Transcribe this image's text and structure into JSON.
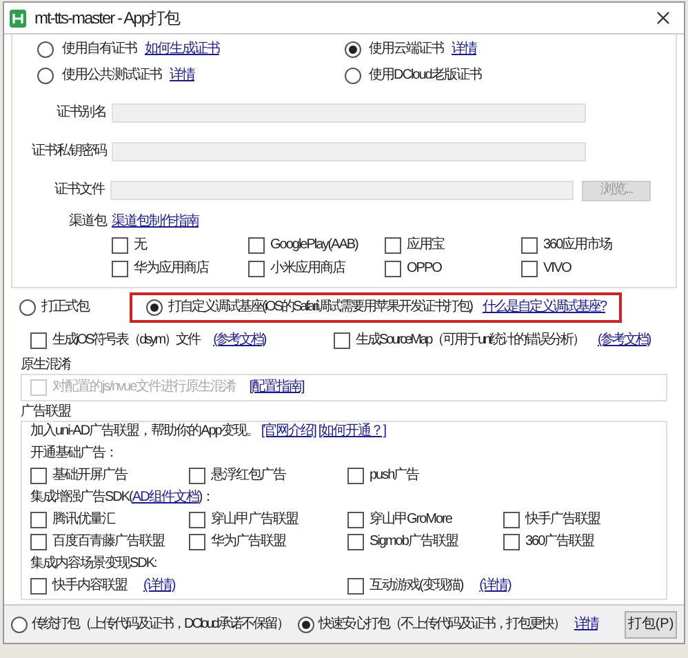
{
  "window": {
    "title": "mt-tts-master - App打包"
  },
  "certificate_options": [
    {
      "label": "使用自有证书",
      "link": "如何生成证书",
      "selected": false
    },
    {
      "label": "使用云端证书",
      "link": "详情",
      "selected": true
    },
    {
      "label": "使用公共测试证书",
      "link": "详情",
      "selected": false
    },
    {
      "label": "使用DCloud老版证书",
      "selected": false
    }
  ],
  "fields": [
    {
      "label": "证书别名"
    },
    {
      "label": "证书私钥密码"
    },
    {
      "label": "证书文件",
      "button": "浏览..."
    }
  ],
  "channel": {
    "label": "渠道包",
    "link": "渠道包制作指南",
    "options": [
      {
        "label": "无",
        "checked": false
      },
      {
        "label": "GooglePlay(AAB)",
        "checked": false
      },
      {
        "label": "应用宝",
        "checked": false
      },
      {
        "label": "360应用市场",
        "checked": false
      },
      {
        "label": "华为应用商店",
        "checked": false
      },
      {
        "label": "小米应用商店",
        "checked": false
      },
      {
        "label": "OPPO",
        "checked": false
      },
      {
        "label": "VIVO",
        "checked": false
      }
    ]
  },
  "package_type": [
    {
      "label": "打正式包",
      "selected": false,
      "highlighted": false
    },
    {
      "label": "打自定义调试基座(iOS的Safari调试需要用苹果开发证书打包)",
      "link": "什么是自定义调试基座?",
      "selected": true,
      "highlighted": true
    }
  ],
  "extra_options": [
    {
      "label": "生成iOS符号表（dsym）文件",
      "link": "(参考文档)",
      "checked": false
    },
    {
      "label": "生成SourceMap（可用于uni统计的错误分析）",
      "link": "(参考文档)",
      "checked": false
    }
  ],
  "obfuscation": {
    "title": "原生混淆",
    "label": "对配置的js/nvue文件进行原生混淆",
    "checked": false,
    "disabled": true,
    "link": "[配置指南]"
  },
  "ads": {
    "title": "广告联盟",
    "intro": "加入uni-AD广告联盟，帮助你的App变现。",
    "intro_links": [
      "[官网介绍]",
      "[如何开通？]"
    ],
    "sections": [
      {
        "kind": "grid4",
        "heading": "开通基础广告：",
        "options": [
          {
            "label": "基础开屏广告",
            "checked": false
          },
          {
            "label": "悬浮红包广告",
            "checked": false
          },
          {
            "label": "push广告",
            "checked": false
          }
        ]
      },
      {
        "kind": "grid4",
        "heading": "集成增强广告SDK(",
        "heading_link": "AD组件文档",
        "heading_end": ")：",
        "options": [
          {
            "label": "腾讯优量汇",
            "checked": false
          },
          {
            "label": "穿山甲广告联盟",
            "checked": false
          },
          {
            "label": "穿山甲GroMore",
            "checked": false
          },
          {
            "label": "快手广告联盟",
            "checked": false
          },
          {
            "label": "百度百青藤广告联盟",
            "checked": false
          },
          {
            "label": "华为广告联盟",
            "checked": false
          },
          {
            "label": "Sigmob广告联盟",
            "checked": false
          },
          {
            "label": "360广告联盟",
            "checked": false
          }
        ]
      },
      {
        "kind": "grid2",
        "heading": "集成内容场景变现SDK:",
        "options": [
          {
            "label": "快手内容联盟",
            "link": "(详情)",
            "checked": false
          },
          {
            "label": "互动游戏(变现猫)",
            "link": "(详情)",
            "checked": false
          }
        ]
      }
    ]
  },
  "bottom": {
    "options": [
      {
        "label": "传统打包（上传代码及证书，DCloud承诺不保留）",
        "selected": false
      },
      {
        "label": "快速安心打包（不上传代码及证书，打包更快）",
        "selected": true
      }
    ],
    "link": "详情",
    "button": "打包(P)"
  }
}
